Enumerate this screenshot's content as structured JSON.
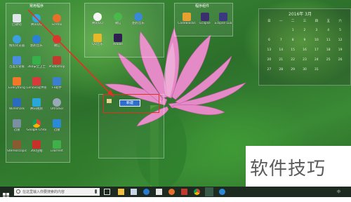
{
  "desktop": {
    "pane_titles": [
      "常用程序",
      "程序组件"
    ],
    "icons_col1": [
      "回收站",
      "搜狗浏览器",
      "百度云管家",
      "Everything",
      "Wireshark",
      "迅雷",
      "Stereoscopic Player"
    ],
    "icons_col2": [
      "腾讯QQ",
      "酷狗音乐",
      "360安全卫士",
      "Lenovo软件管理",
      "腾讯视频",
      "Google Chrome",
      "360压缩"
    ],
    "icons_col3": [
      "Firefox",
      "微信",
      "Photoshop",
      "FF助手",
      "UltraISO",
      "迅雷",
      "uTorrent"
    ],
    "icons_group2": [
      "腾讯QQ",
      "微信",
      "酷狗音乐",
      "QQ音乐",
      "Adobe"
    ],
    "icons_group3": [
      "CodeBlocks",
      "Eclipse",
      "Eclipse Lua"
    ],
    "rename_value": "新建",
    "calendar_title": "2016年 3月",
    "calendar_days": [
      "日",
      "一",
      "二",
      "三",
      "四",
      "五",
      "六",
      "",
      "",
      "1",
      "2",
      "3",
      "4",
      "5",
      "6",
      "7",
      "8",
      "9",
      "10",
      "11",
      "12",
      "13",
      "14",
      "15",
      "16",
      "17",
      "18",
      "19",
      "20",
      "21",
      "22",
      "23",
      "24",
      "25",
      "26",
      "27",
      "28",
      "29",
      "30",
      "31",
      "",
      ""
    ]
  },
  "watermark": "软件技巧",
  "taskbar": {
    "search_placeholder": "在这里输入你要搜索的内容",
    "tray_text": "中"
  },
  "colors": {
    "highlight": "#e53020",
    "selection": "#2d6fd0"
  }
}
